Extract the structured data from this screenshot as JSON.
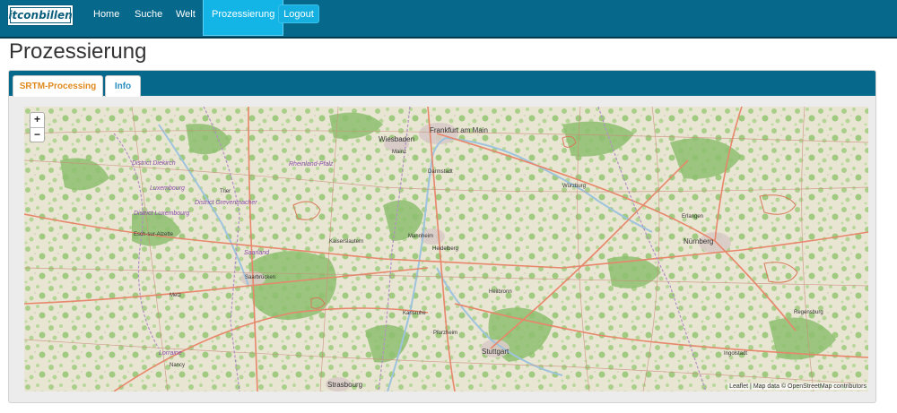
{
  "nav": {
    "logo_text": "itconbillen",
    "items": [
      "Home",
      "Suche",
      "Welt",
      "Prozessierung"
    ],
    "logout": "Logout"
  },
  "page_title": "Prozessierung",
  "tabs": [
    "SRTM-Processing",
    "Info"
  ],
  "map": {
    "zoom_in": "+",
    "zoom_out": "−",
    "attribution": "Leaflet | Map data © OpenStreetMap contributors",
    "cities": {
      "frankfurt": "Frankfurt am Main",
      "wiesbaden": "Wiesbaden",
      "mainz": "Mainz",
      "darmstadt": "Darmstadt",
      "wuerzburg": "Würzburg",
      "erlangen": "Erlangen",
      "nuernberg": "Nürnberg",
      "kaiserslautern": "Kaiserslautern",
      "mannheim": "Mannheim",
      "heidelberg": "Heidelberg",
      "heilbronn": "Heilbronn",
      "saarbruecken": "Saarbrücken",
      "metz": "Metz",
      "karlsruhe": "Karlsruhe",
      "pforzheim": "Pforzheim",
      "stuttgart": "Stuttgart",
      "regensburg": "Regensburg",
      "ingolstadt": "Ingolstadt",
      "nancy": "Nancy",
      "strasbourg": "Strasbourg",
      "trier": "Trier",
      "esch": "Esch-sur-Alzette"
    },
    "regions": {
      "diekirch": "District Diekirch",
      "luxembourg": "Luxembourg",
      "grevenmacher": "District Grevenmacher",
      "district_lux": "District Luxembourg",
      "rheinland": "Rheinland-Pfalz",
      "saarland": "Saarland",
      "lorraine": "Lorraine"
    }
  },
  "colors": {
    "navbar": "#06688a",
    "active_tab_text": "#e08a1e",
    "tab_text": "#2a8fc1",
    "accent": "#12b5e6"
  }
}
